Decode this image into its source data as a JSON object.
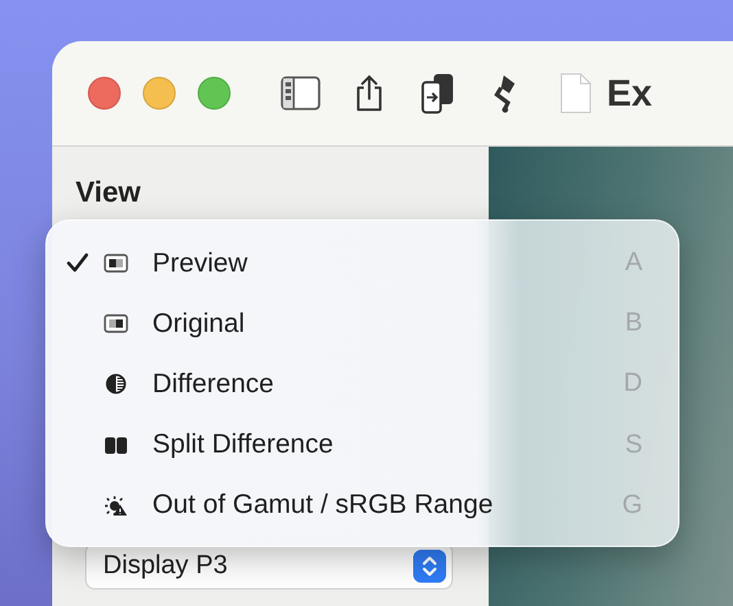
{
  "window": {
    "title": "Ex"
  },
  "sidebar": {
    "heading": "View",
    "color_profile": {
      "value": "Display P3"
    }
  },
  "menu": {
    "items": [
      {
        "label": "Preview",
        "kind": "preview",
        "shortcut": "A",
        "selected": true
      },
      {
        "label": "Original",
        "kind": "original",
        "shortcut": "B",
        "selected": false
      },
      {
        "label": "Difference",
        "kind": "difference",
        "shortcut": "D",
        "selected": false
      },
      {
        "label": "Split Difference",
        "kind": "split",
        "shortcut": "S",
        "selected": false
      },
      {
        "label": "Out of Gamut / sRGB Range",
        "kind": "gamut",
        "shortcut": "G",
        "selected": false
      }
    ]
  }
}
